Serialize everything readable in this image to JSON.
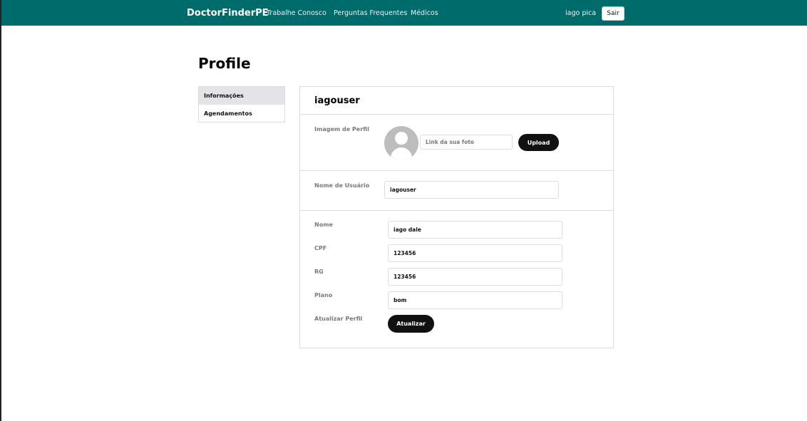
{
  "navbar": {
    "brand": "DoctorFinderPE",
    "links": [
      "Trabalhe Conosco",
      "Perguntas Frequentes",
      "Médicos"
    ],
    "user_name": "iago pica",
    "logout_label": "Sair"
  },
  "page": {
    "title": "Profile"
  },
  "sidebar": {
    "items": [
      {
        "label": "Informações",
        "active": true
      },
      {
        "label": "Agendamentos",
        "active": false
      }
    ]
  },
  "card": {
    "title": "iagouser",
    "profile_image": {
      "label": "Imagem de Perfil",
      "input_value": "",
      "input_placeholder": "Link da sua foto",
      "upload_label": "Upload"
    },
    "username": {
      "label": "Nome de Usuário",
      "value": "iagouser"
    },
    "nome": {
      "label": "Nome",
      "value": "iago dale"
    },
    "cpf": {
      "label": "CPF",
      "value": "123456"
    },
    "rg": {
      "label": "RG",
      "value": "123456"
    },
    "plano": {
      "label": "Plano",
      "value": "bom"
    },
    "update": {
      "label": "Atualizar Perfil",
      "button_label": "Atualizar"
    }
  }
}
